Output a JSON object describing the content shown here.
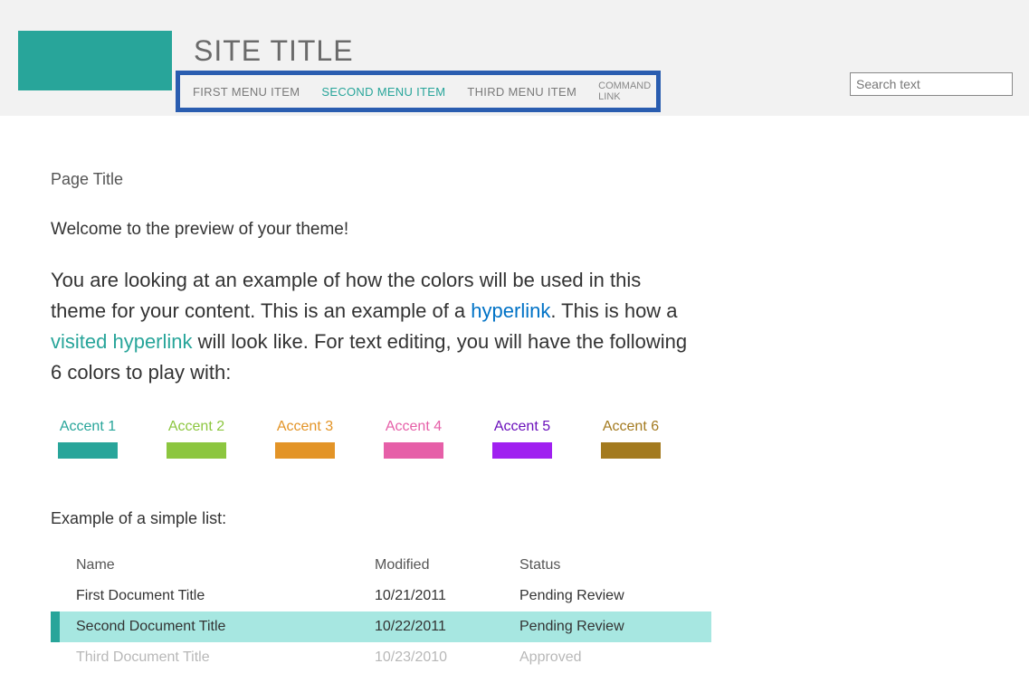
{
  "header": {
    "site_title": "SITE TITLE",
    "search_value": "Search text"
  },
  "nav": {
    "items": [
      {
        "label": "FIRST MENU ITEM",
        "active": false
      },
      {
        "label": "SECOND MENU ITEM",
        "active": true
      },
      {
        "label": "THIRD MENU ITEM",
        "active": false
      }
    ],
    "command_link": "COMMAND LINK"
  },
  "page": {
    "title": "Page Title",
    "welcome": "Welcome to the preview of your theme!",
    "body_pre": "You are looking at an example of how the colors will be used in this theme for your content. This is an example of a ",
    "hyperlink": "hyperlink",
    "body_mid": ". This is how a ",
    "visited_hyperlink": "visited hyperlink",
    "body_post": " will look like. For text editing, you will have the following 6 colors to play with:"
  },
  "accents": [
    {
      "label": "Accent 1",
      "color": "#28a59a"
    },
    {
      "label": "Accent 2",
      "color": "#8cc63f"
    },
    {
      "label": "Accent 3",
      "color": "#e39427"
    },
    {
      "label": "Accent 4",
      "color": "#e65fa8"
    },
    {
      "label": "Accent 5",
      "color": "#a020f0"
    },
    {
      "label": "Accent 6",
      "color": "#a37a1f"
    }
  ],
  "list": {
    "title": "Example of a simple list:",
    "headers": {
      "name": "Name",
      "modified": "Modified",
      "status": "Status"
    },
    "rows": [
      {
        "name": "First Document Title",
        "modified": "10/21/2011",
        "status": "Pending Review",
        "selected": false
      },
      {
        "name": "Second Document Title",
        "modified": "10/22/2011",
        "status": "Pending Review",
        "selected": true
      },
      {
        "name": "Third Document Title",
        "modified": "10/23/2010",
        "status": "Approved",
        "selected": false
      }
    ]
  }
}
